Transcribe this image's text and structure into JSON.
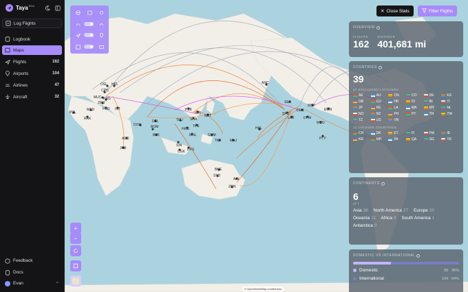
{
  "brand": {
    "name": "Taya",
    "badge": "Beta"
  },
  "nav": {
    "log_flights": "Log Flights",
    "items": [
      {
        "label": "Logbook",
        "count": ""
      },
      {
        "label": "Maps",
        "count": ""
      },
      {
        "label": "Flights",
        "count": "162"
      },
      {
        "label": "Airports",
        "count": "104"
      },
      {
        "label": "Airlines",
        "count": "47"
      },
      {
        "label": "Aircraft",
        "count": "32"
      }
    ]
  },
  "footer": {
    "feedback": "Feedback",
    "docs": "Docs",
    "user": "Evan"
  },
  "toolbar": {
    "close_stats": "Close Stats",
    "filter_flights": "Filter Flights"
  },
  "map": {
    "attribution": "© OpenStreetMap contributors",
    "airports": [
      {
        "code": "OSL"
      },
      {
        "code": "HEL"
      },
      {
        "code": "CPH"
      },
      {
        "code": "MUC"
      },
      {
        "code": "PRG"
      },
      {
        "code": "ZRH"
      },
      {
        "code": "FCO"
      },
      {
        "code": "IST"
      },
      {
        "code": "MAD"
      },
      {
        "code": "PDL"
      },
      {
        "code": "RAK"
      },
      {
        "code": "DOH"
      },
      {
        "code": "DEL"
      },
      {
        "code": "BOM"
      },
      {
        "code": "BLR"
      },
      {
        "code": "ADD"
      },
      {
        "code": "JNB"
      },
      {
        "code": "PEK"
      },
      {
        "code": "ICN"
      },
      {
        "code": "NRT"
      },
      {
        "code": "SHA"
      },
      {
        "code": "TPE"
      },
      {
        "code": "HKG"
      },
      {
        "code": "TFU"
      },
      {
        "code": "MNL"
      },
      {
        "code": "CGK"
      },
      {
        "code": "SIN"
      },
      {
        "code": "DPS"
      },
      {
        "code": "GUM"
      },
      {
        "code": "TKK"
      },
      {
        "code": "MAJ"
      },
      {
        "code": "BNE"
      },
      {
        "code": "SYD"
      },
      {
        "code": "AKL"
      },
      {
        "code": "ZQN"
      },
      {
        "code": "HNL"
      },
      {
        "code": "ANC"
      },
      {
        "code": "SEA"
      },
      {
        "code": "SFO"
      },
      {
        "code": "LAX"
      },
      {
        "code": "DEN"
      },
      {
        "code": "MSP"
      },
      {
        "code": "DFW"
      },
      {
        "code": "MCO"
      },
      {
        "code": "EWR"
      },
      {
        "code": "PTY"
      }
    ]
  },
  "stats": {
    "overview": {
      "title": "OVERVIEW",
      "flights_label": "FLIGHTS",
      "flights": "162",
      "distance_label": "DISTANCE",
      "distance": "401,681 mi"
    },
    "countries": {
      "title": "COUNTRIES",
      "count": "39",
      "excluding_label": "27 EXCLUDING LAYOVERS",
      "list": [
        "AE",
        "AU",
        "CN",
        "CO",
        "DE",
        "ES",
        "GB",
        "GU",
        "HK",
        "ID",
        "IN",
        "IT",
        "JP",
        "KE",
        "LA",
        "MA",
        "MY",
        "NL",
        "NO",
        "NZ",
        "PH",
        "PT",
        "TH",
        "TW",
        "TZ",
        "US",
        "VN"
      ],
      "layover_label": "12 LAYOVER COUNTRIES",
      "layovers": [
        "CH",
        "DK",
        "ET",
        "FI",
        "FM",
        "IE",
        "KR",
        "MH",
        "PA",
        "QA",
        "SG",
        "TR"
      ]
    },
    "continents": {
      "title": "CONTINENTS",
      "count": "6",
      "of_label": "of 7",
      "rows": [
        [
          {
            "name": "Asia",
            "n": "36"
          },
          {
            "name": "North America",
            "n": "27"
          },
          {
            "name": "Europe",
            "n": "20"
          }
        ],
        [
          {
            "name": "Oceania",
            "n": "11"
          },
          {
            "name": "Africa",
            "n": "9"
          },
          {
            "name": "South America",
            "n": "1"
          }
        ],
        [
          {
            "name": "Antarctica",
            "n": "0"
          }
        ]
      ]
    },
    "domestic_intl": {
      "title": "DOMESTIC VS INTERNATIONAL",
      "domestic_label": "Domestic",
      "domestic_value": "58 · 36%",
      "domestic_fraction": 0.36,
      "international_label": "International",
      "international_value": "104 · 64%",
      "colors": {
        "domestic": "#c4b5fd",
        "international": "#7a7cc4"
      }
    }
  }
}
